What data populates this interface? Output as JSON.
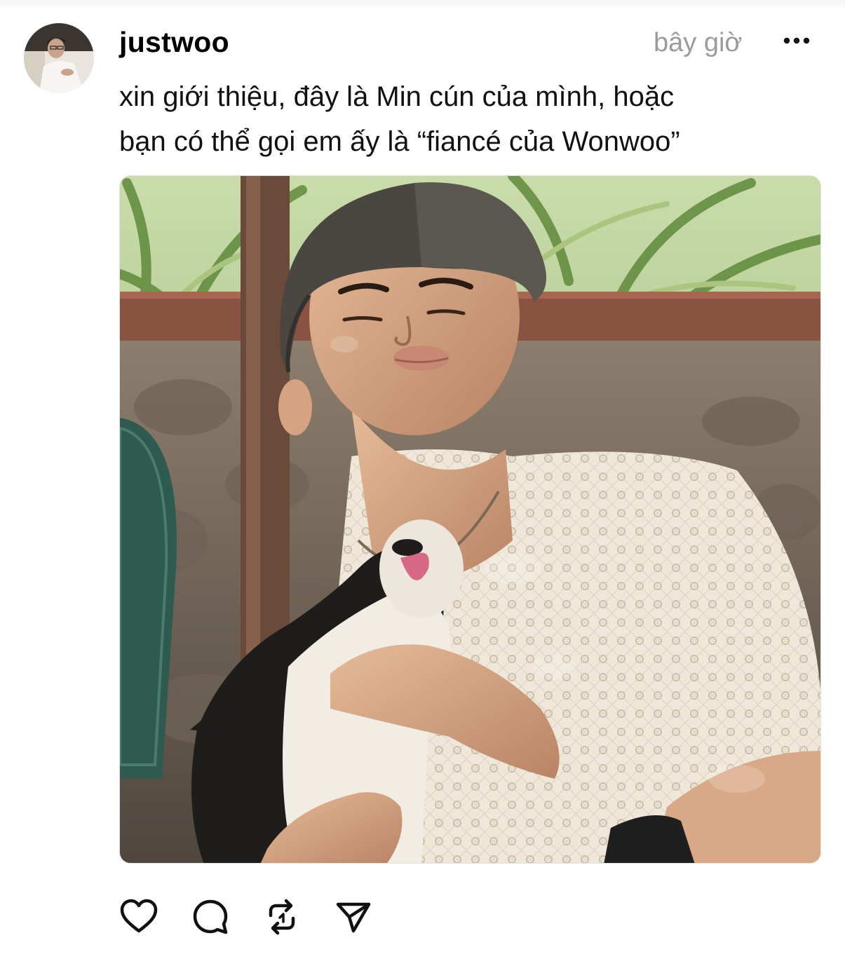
{
  "post": {
    "username": "justwoo",
    "timestamp": "bây giờ",
    "caption_lines": [
      "xin giới thiệu, đây là Min cún của mình, hoặc",
      "bạn có thể gọi em ấy là “fiancé của Wonwoo”"
    ],
    "photo": {
      "subject": "man in cap and white lace shirt hugging a black-and-white dog"
    },
    "icons": {
      "avatar": "profile-avatar",
      "more": "more-horizontal-icon",
      "like": "heart-icon",
      "comment": "comment-bubble-icon",
      "repost": "repost-icon",
      "share": "send-icon"
    }
  },
  "colors": {
    "text": "#000000",
    "muted": "#9b9b9b",
    "background": "#ffffff"
  }
}
